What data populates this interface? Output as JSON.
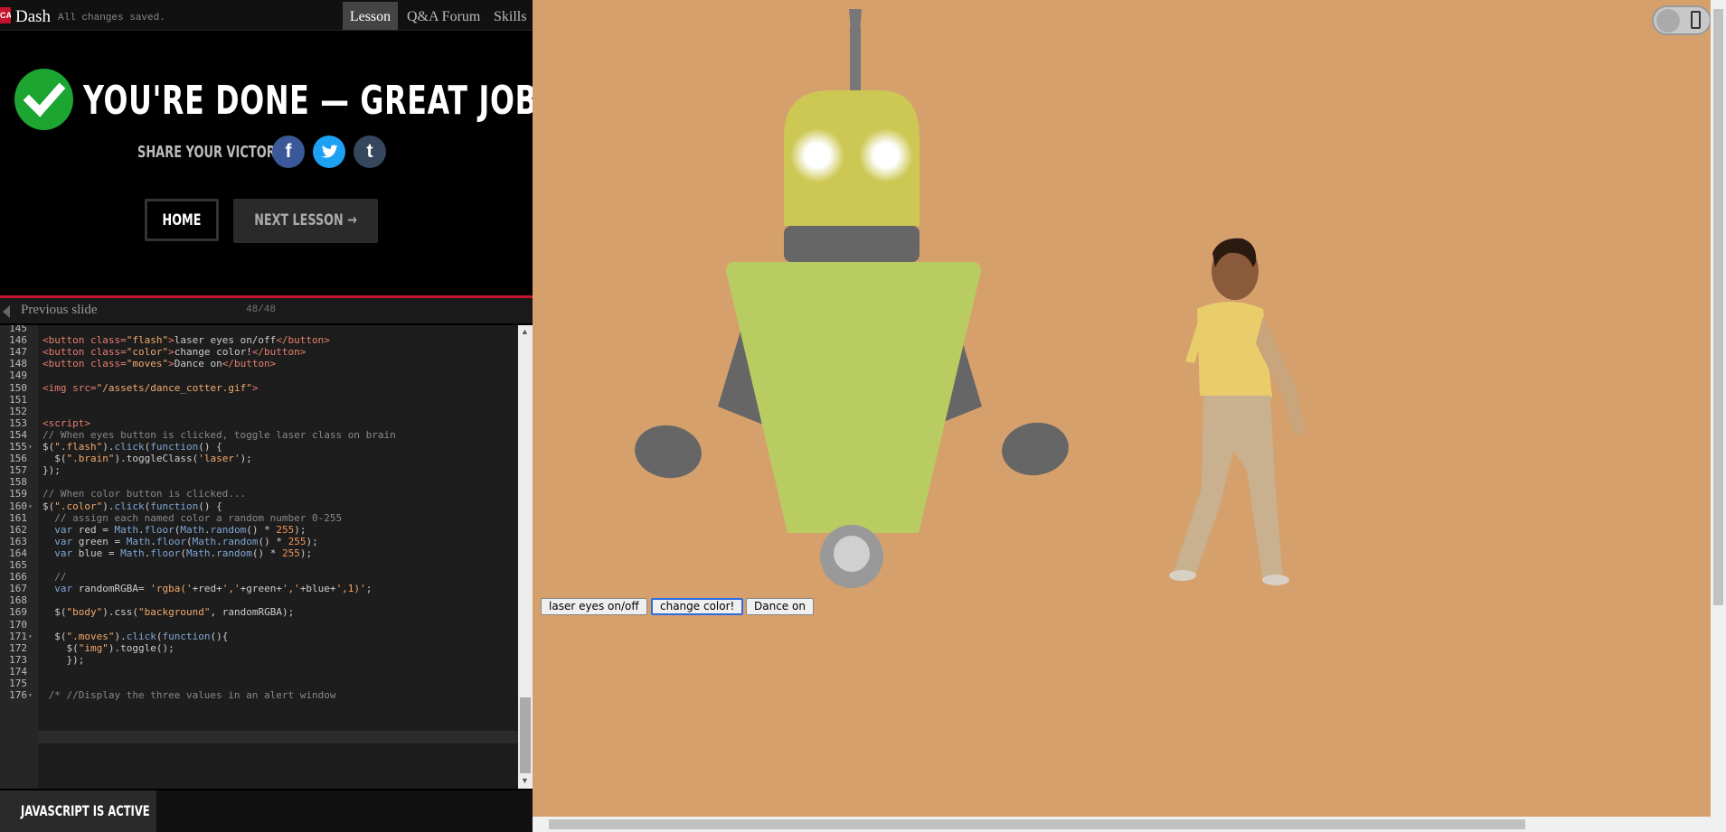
{
  "topbar": {
    "logo": "CA",
    "brand": "Dash",
    "status": "All changes saved.",
    "tabs": [
      "Lesson",
      "Q&A Forum",
      "Skills"
    ]
  },
  "done": {
    "title": "YOU'RE DONE — GREAT JOB!",
    "share_label": "SHARE YOUR VICTORY:",
    "social": {
      "facebook": "f",
      "twitter": "twitter-icon",
      "tumblr": "t"
    },
    "home_label": "HOME",
    "next_label": "NEXT LESSON →"
  },
  "slides": {
    "prev_label": "Previous slide",
    "counter": "48/48"
  },
  "editor": {
    "lines": [
      {
        "n": "145",
        "fold": "",
        "html": ""
      },
      {
        "n": "146",
        "fold": "",
        "html": "<span class=\"tag\">&lt;button</span> <span class=\"tag\">class=</span><span class=\"str\">\"flash\"</span><span class=\"tag\">&gt;</span>laser eyes on/off<span class=\"tag\">&lt;/button&gt;</span>"
      },
      {
        "n": "147",
        "fold": "",
        "html": "<span class=\"tag\">&lt;button</span> <span class=\"tag\">class=</span><span class=\"str\">\"color\"</span><span class=\"tag\">&gt;</span>change color!<span class=\"tag\">&lt;/button&gt;</span>"
      },
      {
        "n": "148",
        "fold": "",
        "html": "<span class=\"tag\">&lt;button</span> <span class=\"tag\">class=</span><span class=\"str\">\"moves\"</span><span class=\"tag\">&gt;</span>Dance on<span class=\"tag\">&lt;/button&gt;</span>"
      },
      {
        "n": "149",
        "fold": "",
        "html": ""
      },
      {
        "n": "150",
        "fold": "",
        "html": "<span class=\"tag\">&lt;img</span> <span class=\"tag\">src=</span><span class=\"str\">\"/assets/dance_cotter.gif\"</span><span class=\"tag\">&gt;</span>"
      },
      {
        "n": "151",
        "fold": "",
        "html": ""
      },
      {
        "n": "152",
        "fold": "",
        "html": ""
      },
      {
        "n": "153",
        "fold": "",
        "html": "<span class=\"tag\">&lt;script&gt;</span>"
      },
      {
        "n": "154",
        "fold": "",
        "html": "<span class=\"cmt\">// When eyes button is clicked, toggle laser class on brain</span>"
      },
      {
        "n": "155",
        "fold": "▾",
        "html": "$(<span class=\"str\">\".flash\"</span>).<span class=\"fn\">click</span>(<span class=\"kw\">function</span>() {"
      },
      {
        "n": "156",
        "fold": "",
        "html": "  $(<span class=\"str\">\".brain\"</span>).toggleClass(<span class=\"str\">'laser'</span>);"
      },
      {
        "n": "157",
        "fold": "",
        "html": "});"
      },
      {
        "n": "158",
        "fold": "",
        "html": ""
      },
      {
        "n": "159",
        "fold": "",
        "html": "<span class=\"cmt\">// When color button is clicked...</span>"
      },
      {
        "n": "160",
        "fold": "▾",
        "html": "$(<span class=\"str\">\".color\"</span>).<span class=\"fn\">click</span>(<span class=\"kw\">function</span>() {"
      },
      {
        "n": "161",
        "fold": "",
        "html": "  <span class=\"cmt\">// assign each named color a random number 0-255</span>"
      },
      {
        "n": "162",
        "fold": "",
        "html": "  <span class=\"kw\">var</span> red = <span class=\"fn\">Math</span>.<span class=\"fn\">floor</span>(<span class=\"fn\">Math</span>.<span class=\"fn\">random</span>() * <span class=\"num\">255</span>);"
      },
      {
        "n": "163",
        "fold": "",
        "html": "  <span class=\"kw\">var</span> green = <span class=\"fn\">Math</span>.<span class=\"fn\">floor</span>(<span class=\"fn\">Math</span>.<span class=\"fn\">random</span>() * <span class=\"num\">255</span>);"
      },
      {
        "n": "164",
        "fold": "",
        "html": "  <span class=\"kw\">var</span> blue = <span class=\"fn\">Math</span>.<span class=\"fn\">floor</span>(<span class=\"fn\">Math</span>.<span class=\"fn\">random</span>() * <span class=\"num\">255</span>);"
      },
      {
        "n": "165",
        "fold": "",
        "html": ""
      },
      {
        "n": "166",
        "fold": "",
        "html": "  <span class=\"cmt\">//</span>"
      },
      {
        "n": "167",
        "fold": "",
        "html": "  <span class=\"kw\">var</span> randomRGBA= <span class=\"str\">'rgba('</span>+red+<span class=\"str\">','</span>+green+<span class=\"str\">','</span>+blue+<span class=\"str\">',1)'</span>;"
      },
      {
        "n": "168",
        "fold": "",
        "html": ""
      },
      {
        "n": "169",
        "fold": "",
        "html": "  $(<span class=\"str\">\"body\"</span>).css(<span class=\"str\">\"background\"</span>, randomRGBA);"
      },
      {
        "n": "170",
        "fold": "",
        "html": ""
      },
      {
        "n": "171",
        "fold": "▾",
        "html": "  $(<span class=\"str\">\".moves\"</span>).<span class=\"fn\">click</span>(<span class=\"kw\">function</span>(){"
      },
      {
        "n": "172",
        "fold": "",
        "html": "    $(<span class=\"str\">\"img\"</span>).toggle();"
      },
      {
        "n": "173",
        "fold": "",
        "html": "    });"
      },
      {
        "n": "174",
        "fold": "",
        "html": ""
      },
      {
        "n": "175",
        "fold": "",
        "html": ""
      },
      {
        "n": "176",
        "fold": "▾",
        "html": " <span class=\"cmt\">/* //Display the three values in an alert window</span>"
      }
    ]
  },
  "status": {
    "js_active": "JAVASCRIPT IS ACTIVE"
  },
  "preview": {
    "background": "#d6a06d",
    "buttons": [
      "laser eyes on/off",
      "change color!",
      "Dance on"
    ],
    "focused_button": "change color!"
  },
  "colors": {
    "robot_head": "#cdc854",
    "robot_body": "#b8cc62",
    "robot_limbs": "#666666",
    "accent_red": "#c4122f",
    "success_green": "#1da532"
  }
}
